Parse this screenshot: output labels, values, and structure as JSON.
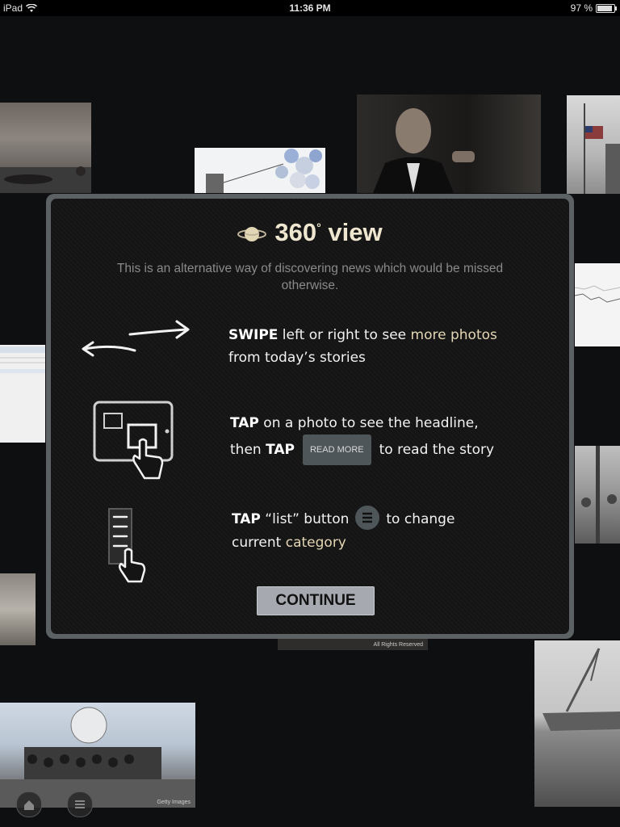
{
  "status_bar": {
    "device": "iPad",
    "time": "11:36 PM",
    "battery": "97 %"
  },
  "overlay": {
    "title": "360",
    "title_degree": "°",
    "title_suffix": " view",
    "subtitle": "This is an alternative way of discovering news which would be missed otherwise.",
    "swipe": {
      "action": "SWIPE",
      "text_a": " left or right to see ",
      "highlight": "more photos",
      "text_b": "from today’s stories"
    },
    "tap": {
      "action": "TAP",
      "text_a": " on a photo to see the headline,",
      "then": "then ",
      "action2": "TAP",
      "read_more_label": "READ MORE",
      "text_b": "to read the story"
    },
    "list": {
      "action": "TAP",
      "text_a": " “list” button",
      "text_b": "to change",
      "text_c": "current ",
      "highlight": "category"
    },
    "continue_label": "CONTINUE"
  },
  "photo_captions": {
    "tile_bottom_center": "All Rights Reserved",
    "tile_bottom_left": "Getty Images"
  },
  "colors": {
    "background": "#0e0f11",
    "panel_border": "#5c6164",
    "title": "#efe6cf",
    "highlight": "#e3d6b4",
    "continue_button": "#a6aab0"
  }
}
